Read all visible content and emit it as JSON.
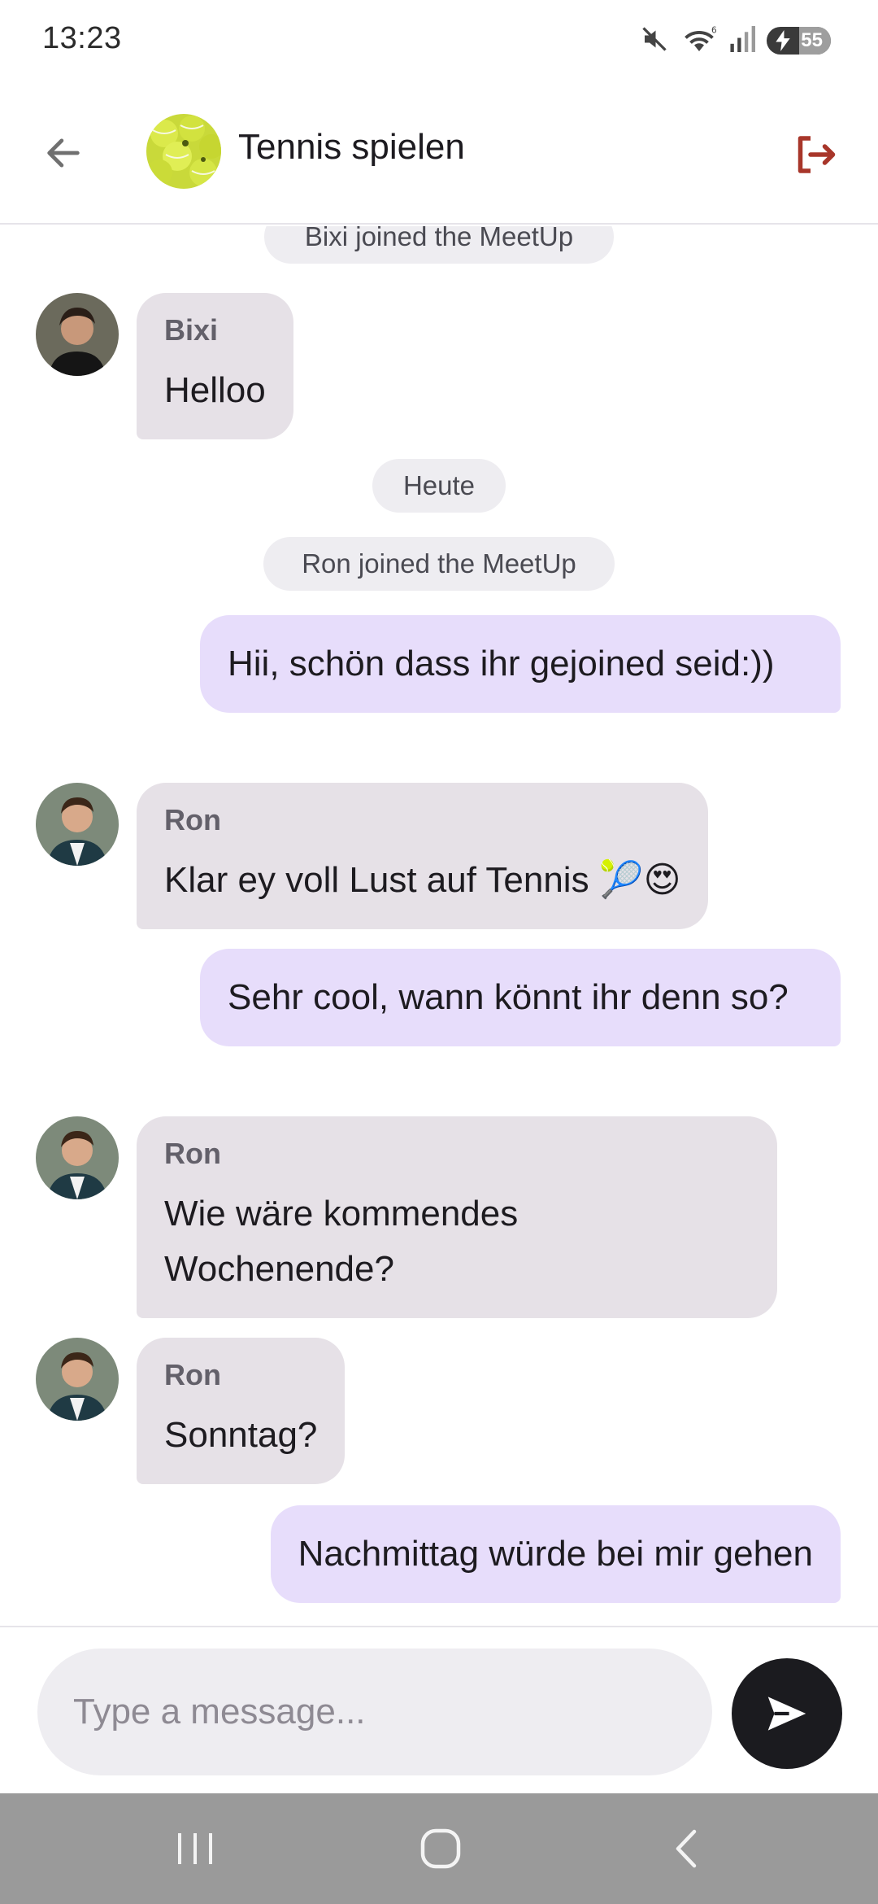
{
  "status_bar": {
    "time": "13:23",
    "battery_level": "55"
  },
  "header": {
    "title": "Tennis spielen",
    "back_icon": "arrow-left-icon",
    "leave_icon": "logout-icon"
  },
  "chat": {
    "system_bixi_joined": "Bixi joined the MeetUp",
    "date_divider": "Heute",
    "system_ron_joined": "Ron joined the MeetUp",
    "messages": [
      {
        "sender": "Bixi",
        "text": "Helloo"
      },
      {
        "text": "Hii, schön dass ihr gejoined seid:))"
      },
      {
        "sender": "Ron",
        "text": "Klar ey voll Lust auf Tennis 🎾😍"
      },
      {
        "text": "Sehr cool, wann könnt ihr denn so?"
      },
      {
        "sender": "Ron",
        "text": "Wie wäre kommendes Wochenende?"
      },
      {
        "sender": "Ron",
        "text": "Sonntag?"
      },
      {
        "text": "Nachmittag würde bei mir gehen"
      }
    ]
  },
  "composer": {
    "placeholder": "Type a message...",
    "send_icon": "send-icon"
  },
  "nav": {
    "recents_icon": "recents-icon",
    "home_icon": "home-icon",
    "back_icon": "back-chevron-icon"
  },
  "colors": {
    "incoming_bubble": "#e6e1e7",
    "outgoing_bubble": "#e7ddfb",
    "leave_icon": "#a8362a",
    "send_button": "#1b1b1f"
  }
}
